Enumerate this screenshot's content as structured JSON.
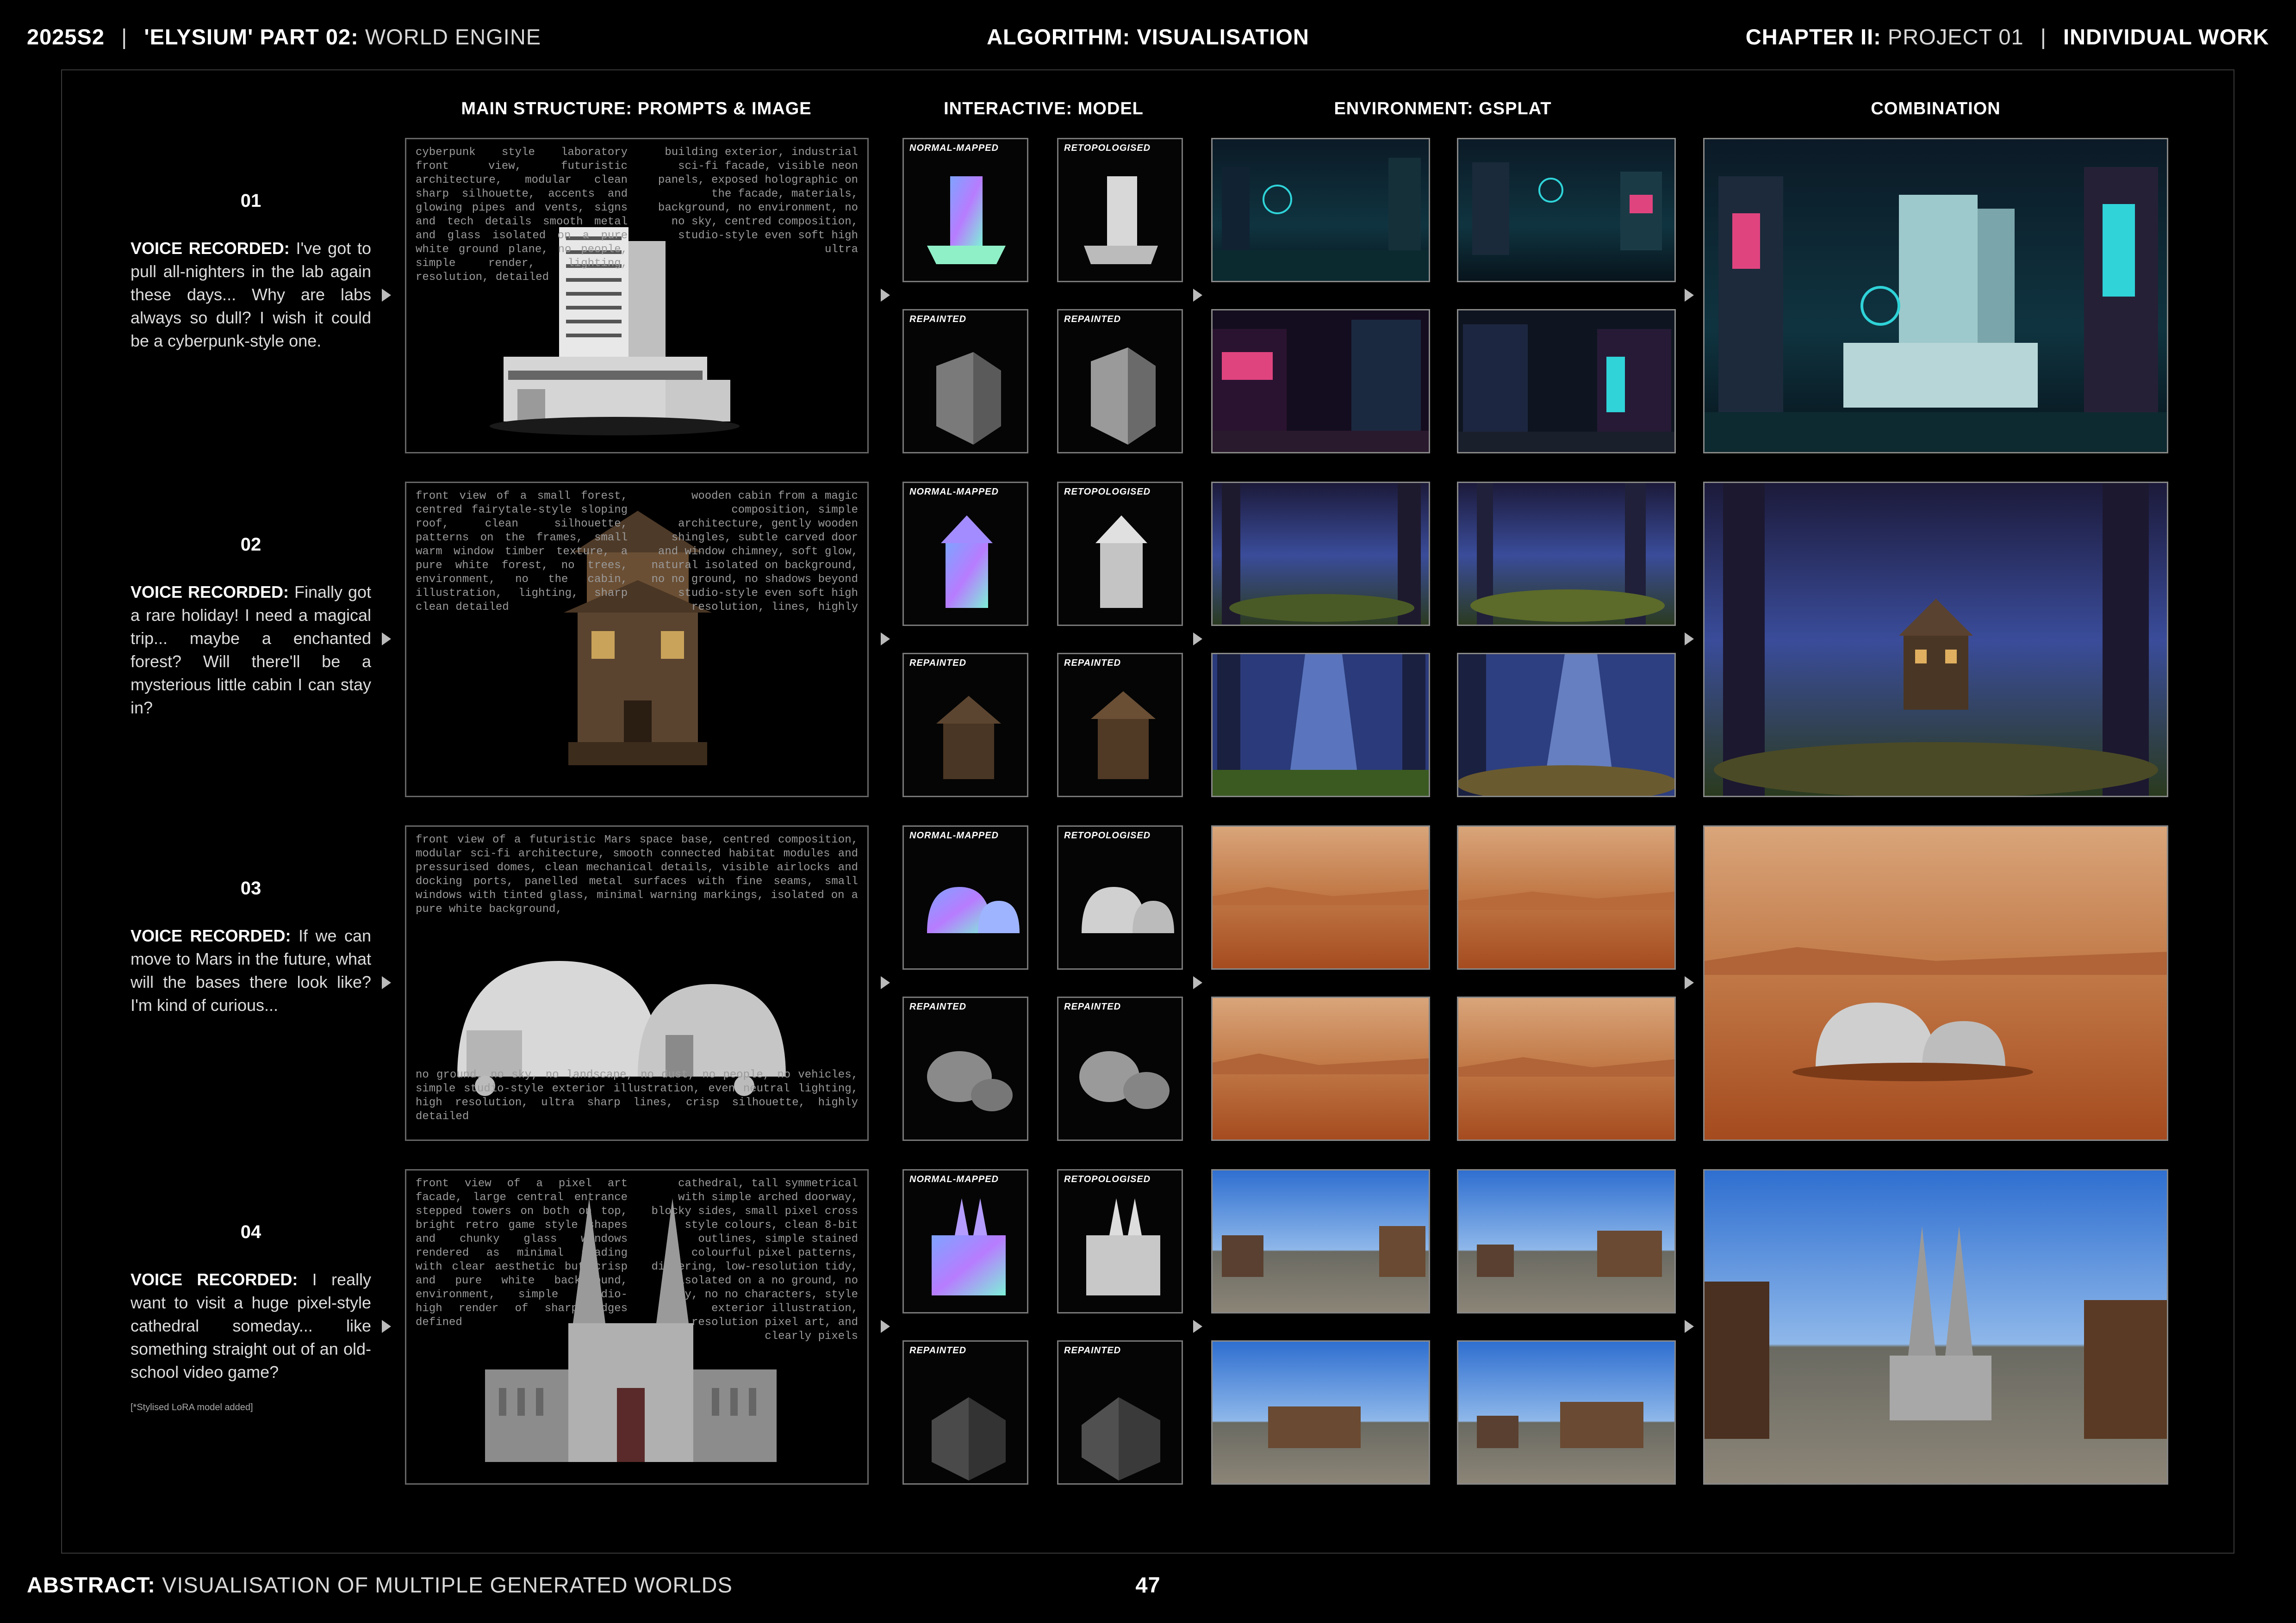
{
  "header": {
    "left_code": "2025S2",
    "left_sep": "|",
    "left_title_bold": "'ELYSIUM' PART 02:",
    "left_title_rest": "WORLD ENGINE",
    "center": "ALGORITHM: VISUALISATION",
    "right_chapter_bold": "CHAPTER II:",
    "right_chapter_rest": "PROJECT 01",
    "right_sep": "|",
    "right_work": "INDIVIDUAL WORK"
  },
  "columns": {
    "main": "MAIN STRUCTURE: PROMPTS & IMAGE",
    "interactive": "INTERACTIVE: MODEL",
    "environment": "ENVIRONMENT: GSPLAT",
    "combination": "COMBINATION"
  },
  "model_labels": {
    "normal": "NORMAL-MAPPED",
    "retopo": "RETOPOLOGISED",
    "repainted": "REPAINTED"
  },
  "rows": [
    {
      "number": "01",
      "voice_label": "VOICE RECORDED:",
      "voice_text": "I've got to pull all-nighters in the lab again these days... Why are labs always so dull? I wish it could be a cyberpunk-style one.",
      "prompt_left": "cyberpunk style laboratory front view, futuristic architecture, modular clean sharp silhouette, accents and glowing pipes and vents, signs and tech details smooth metal and glass isolated on a pure white ground plane, no people,  simple render, lighting, resolution, detailed",
      "prompt_right": "building exterior, industrial sci-fi facade, visible neon panels, exposed holographic on the facade, materials, background, no environment, no no sky, centred composition, studio-style even soft high ultra",
      "prompt_bottom": "",
      "note": ""
    },
    {
      "number": "02",
      "voice_label": "VOICE RECORDED:",
      "voice_text": "Finally got a rare holiday! I need a magical trip... maybe a enchanted forest? Will there'll be a mysterious little cabin I can stay in?",
      "prompt_left": "front view of a small forest, centred fairytale-style sloping roof, clean silhouette, patterns on the frames, small warm window timber texture, a pure white forest, no trees, environment, no the cabin, illustration, lighting, sharp clean detailed",
      "prompt_right": "wooden cabin from a magic composition, simple architecture, gently wooden shingles, subtle carved door and window chimney, soft glow, natural isolated on background, no no ground, no shadows beyond studio-style even soft high resolution, lines, highly",
      "prompt_bottom": "",
      "note": ""
    },
    {
      "number": "03",
      "voice_label": "VOICE RECORDED:",
      "voice_text": "If we can move to Mars in the future, what will the bases there look like? I'm kind of curious...",
      "prompt_left": "front view of a futuristic Mars space base, centred composition, modular sci-fi architecture, smooth connected habitat modules and pressurised domes, clean mechanical details, visible airlocks and docking ports, panelled metal surfaces with fine seams, small windows with tinted glass, minimal warning markings, isolated on a pure white background,",
      "prompt_right": "",
      "prompt_bottom": "no ground, no sky, no landscape, no dust, no people, no vehicles, simple studio-style exterior illustration, even neutral lighting, high resolution, ultra sharp lines, crisp silhouette, highly detailed",
      "note": ""
    },
    {
      "number": "04",
      "voice_label": "VOICE RECORDED:",
      "voice_text": "I really want to visit a huge pixel-style cathedral someday... like something straight out of an old-school video game?",
      "prompt_left": "front view of a pixel art facade, large central entrance stepped towers on both on top, bright retro game style shapes and chunky glass windows rendered as minimal shading with clear aesthetic but crisp and pure white background, environment, simple studio-  high render of sharp edges defined",
      "prompt_right": "cathedral, tall symmetrical with simple arched doorway, blocky sides, small pixel cross style colours, clean 8-bit outlines, simple stained colourful pixel patterns, dithering, low-resolution tidy, isolated on a no ground, no sky, no no characters, style exterior illustration, resolution pixel art, and clearly pixels",
      "prompt_bottom": "",
      "note": "[*Stylised LoRA model added]"
    }
  ],
  "footer": {
    "abstract_bold": "ABSTRACT:",
    "abstract_rest": "VISUALISATION OF MULTIPLE GENERATED WORLDS",
    "page_number": "47"
  },
  "colors": {
    "background": "#000000",
    "cyber_teal": "#2fd3d8",
    "cyber_pink": "#e0447f",
    "forest_blue": "#4a5ab8",
    "mars_orange": "#c8662e",
    "sky_blue": "#3c7fd6"
  }
}
